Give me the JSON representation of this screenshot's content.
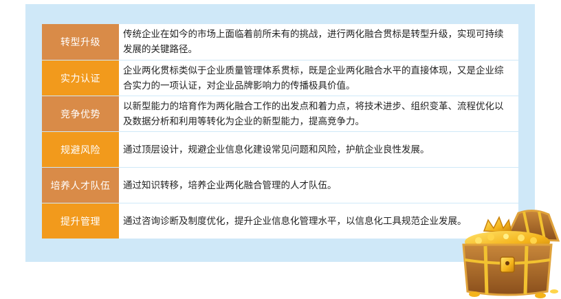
{
  "rows": [
    {
      "label": "转型升级",
      "desc": "传统企业在如今的市场上面临着前所未有的挑战，进行两化融合贯标是转型升级，实现可持续发展的关键路径。",
      "color": "brown"
    },
    {
      "label": "实力认证",
      "desc": "企业两化贯标类似于企业质量管理体系贯标，既是企业两化融合水平的直接体现，又是企业综合实力的一项认证，对企业品牌影响力的传播极具价值。",
      "color": "orange"
    },
    {
      "label": "竞争优势",
      "desc": "以新型能力的培育作为两化融合工作的出发点和着力点，将技术进步、组织变革、流程优化以及数据分析和利用等转化为企业的新型能力，提高竞争力。",
      "color": "brown"
    },
    {
      "label": "规避风险",
      "desc": "通过顶层设计，规避企业信息化建设常见问题和风险，护航企业良性发展。",
      "color": "orange"
    },
    {
      "label": "培养人才队伍",
      "desc": "通过知识转移，培养企业两化融合管理的人才队伍。",
      "color": "brown"
    },
    {
      "label": "提升管理",
      "desc": "通过咨询诊断及制度优化，提升企业信息化管理水平，以信息化工具规范企业发展。",
      "color": "orange"
    }
  ],
  "colors": {
    "panel_bg": "#cfe8f8",
    "label_orange": "#f29a1c",
    "label_brown": "#d98b48"
  },
  "decoration": {
    "icon": "treasure-chest-icon"
  }
}
